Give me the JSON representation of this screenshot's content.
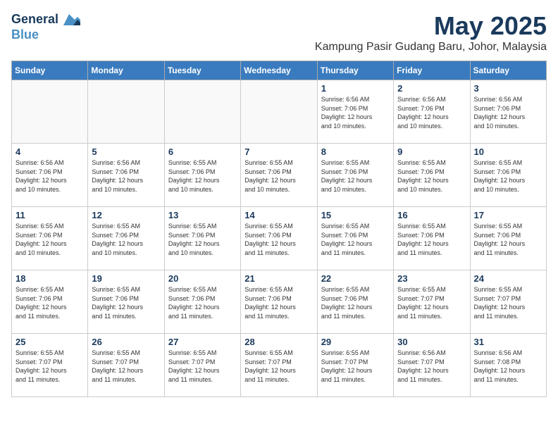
{
  "logo": {
    "line1": "General",
    "line2": "Blue"
  },
  "title": "May 2025",
  "location": "Kampung Pasir Gudang Baru, Johor, Malaysia",
  "headers": [
    "Sunday",
    "Monday",
    "Tuesday",
    "Wednesday",
    "Thursday",
    "Friday",
    "Saturday"
  ],
  "weeks": [
    [
      {
        "day": "",
        "info": ""
      },
      {
        "day": "",
        "info": ""
      },
      {
        "day": "",
        "info": ""
      },
      {
        "day": "",
        "info": ""
      },
      {
        "day": "1",
        "info": "Sunrise: 6:56 AM\nSunset: 7:06 PM\nDaylight: 12 hours\nand 10 minutes."
      },
      {
        "day": "2",
        "info": "Sunrise: 6:56 AM\nSunset: 7:06 PM\nDaylight: 12 hours\nand 10 minutes."
      },
      {
        "day": "3",
        "info": "Sunrise: 6:56 AM\nSunset: 7:06 PM\nDaylight: 12 hours\nand 10 minutes."
      }
    ],
    [
      {
        "day": "4",
        "info": "Sunrise: 6:56 AM\nSunset: 7:06 PM\nDaylight: 12 hours\nand 10 minutes."
      },
      {
        "day": "5",
        "info": "Sunrise: 6:56 AM\nSunset: 7:06 PM\nDaylight: 12 hours\nand 10 minutes."
      },
      {
        "day": "6",
        "info": "Sunrise: 6:55 AM\nSunset: 7:06 PM\nDaylight: 12 hours\nand 10 minutes."
      },
      {
        "day": "7",
        "info": "Sunrise: 6:55 AM\nSunset: 7:06 PM\nDaylight: 12 hours\nand 10 minutes."
      },
      {
        "day": "8",
        "info": "Sunrise: 6:55 AM\nSunset: 7:06 PM\nDaylight: 12 hours\nand 10 minutes."
      },
      {
        "day": "9",
        "info": "Sunrise: 6:55 AM\nSunset: 7:06 PM\nDaylight: 12 hours\nand 10 minutes."
      },
      {
        "day": "10",
        "info": "Sunrise: 6:55 AM\nSunset: 7:06 PM\nDaylight: 12 hours\nand 10 minutes."
      }
    ],
    [
      {
        "day": "11",
        "info": "Sunrise: 6:55 AM\nSunset: 7:06 PM\nDaylight: 12 hours\nand 10 minutes."
      },
      {
        "day": "12",
        "info": "Sunrise: 6:55 AM\nSunset: 7:06 PM\nDaylight: 12 hours\nand 10 minutes."
      },
      {
        "day": "13",
        "info": "Sunrise: 6:55 AM\nSunset: 7:06 PM\nDaylight: 12 hours\nand 10 minutes."
      },
      {
        "day": "14",
        "info": "Sunrise: 6:55 AM\nSunset: 7:06 PM\nDaylight: 12 hours\nand 11 minutes."
      },
      {
        "day": "15",
        "info": "Sunrise: 6:55 AM\nSunset: 7:06 PM\nDaylight: 12 hours\nand 11 minutes."
      },
      {
        "day": "16",
        "info": "Sunrise: 6:55 AM\nSunset: 7:06 PM\nDaylight: 12 hours\nand 11 minutes."
      },
      {
        "day": "17",
        "info": "Sunrise: 6:55 AM\nSunset: 7:06 PM\nDaylight: 12 hours\nand 11 minutes."
      }
    ],
    [
      {
        "day": "18",
        "info": "Sunrise: 6:55 AM\nSunset: 7:06 PM\nDaylight: 12 hours\nand 11 minutes."
      },
      {
        "day": "19",
        "info": "Sunrise: 6:55 AM\nSunset: 7:06 PM\nDaylight: 12 hours\nand 11 minutes."
      },
      {
        "day": "20",
        "info": "Sunrise: 6:55 AM\nSunset: 7:06 PM\nDaylight: 12 hours\nand 11 minutes."
      },
      {
        "day": "21",
        "info": "Sunrise: 6:55 AM\nSunset: 7:06 PM\nDaylight: 12 hours\nand 11 minutes."
      },
      {
        "day": "22",
        "info": "Sunrise: 6:55 AM\nSunset: 7:06 PM\nDaylight: 12 hours\nand 11 minutes."
      },
      {
        "day": "23",
        "info": "Sunrise: 6:55 AM\nSunset: 7:07 PM\nDaylight: 12 hours\nand 11 minutes."
      },
      {
        "day": "24",
        "info": "Sunrise: 6:55 AM\nSunset: 7:07 PM\nDaylight: 12 hours\nand 11 minutes."
      }
    ],
    [
      {
        "day": "25",
        "info": "Sunrise: 6:55 AM\nSunset: 7:07 PM\nDaylight: 12 hours\nand 11 minutes."
      },
      {
        "day": "26",
        "info": "Sunrise: 6:55 AM\nSunset: 7:07 PM\nDaylight: 12 hours\nand 11 minutes."
      },
      {
        "day": "27",
        "info": "Sunrise: 6:55 AM\nSunset: 7:07 PM\nDaylight: 12 hours\nand 11 minutes."
      },
      {
        "day": "28",
        "info": "Sunrise: 6:55 AM\nSunset: 7:07 PM\nDaylight: 12 hours\nand 11 minutes."
      },
      {
        "day": "29",
        "info": "Sunrise: 6:55 AM\nSunset: 7:07 PM\nDaylight: 12 hours\nand 11 minutes."
      },
      {
        "day": "30",
        "info": "Sunrise: 6:56 AM\nSunset: 7:07 PM\nDaylight: 12 hours\nand 11 minutes."
      },
      {
        "day": "31",
        "info": "Sunrise: 6:56 AM\nSunset: 7:08 PM\nDaylight: 12 hours\nand 11 minutes."
      }
    ]
  ]
}
